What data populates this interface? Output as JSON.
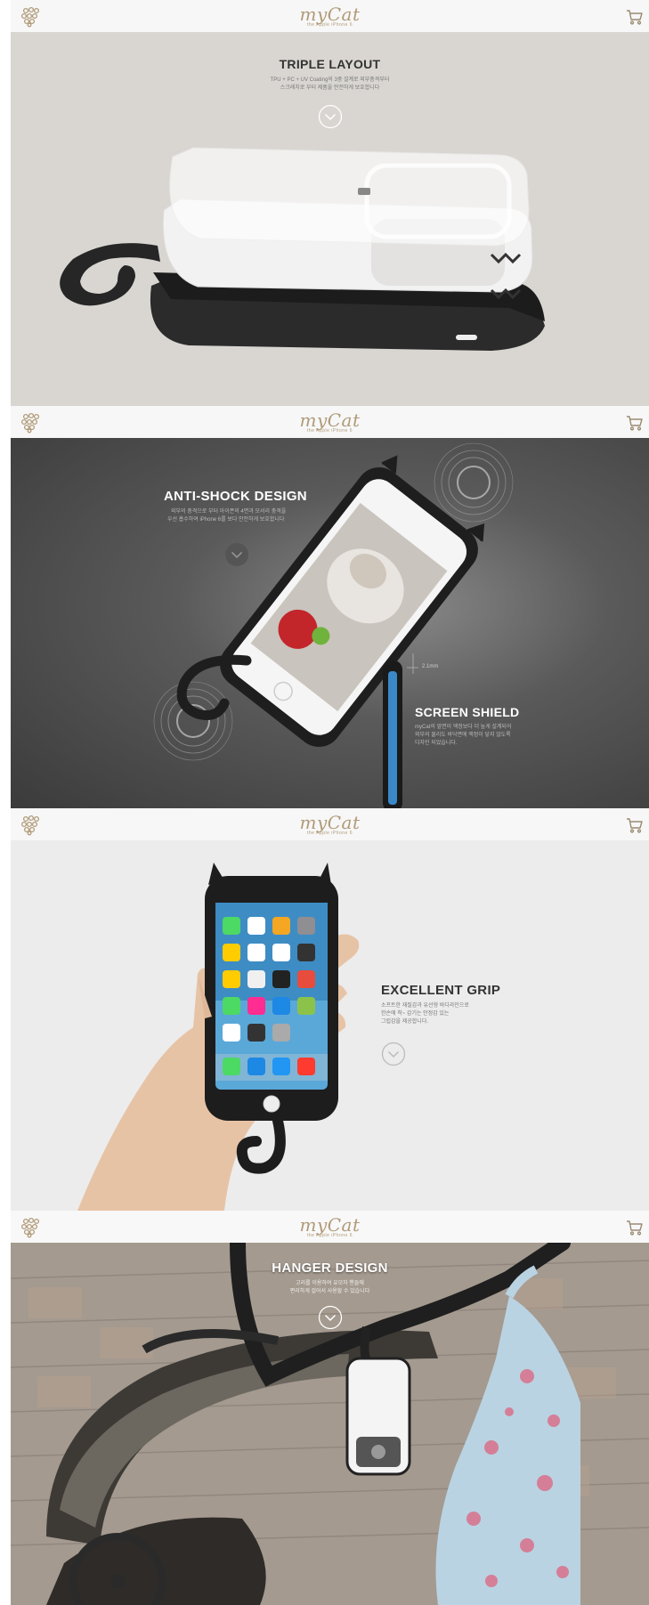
{
  "header": {
    "brand": "myCat",
    "brand_sub": "the Apple iPhone 6"
  },
  "section1": {
    "title": "TRIPLE LAYOUT",
    "desc_line1": "TPU + PC + UV Coating의 3중 설계로 외부충격부터",
    "desc_line2": "스크래치로 부터 제품을 안전하게 보호합니다"
  },
  "section2": {
    "title": "ANTI-SHOCK DESIGN",
    "desc_line1": "외부의 충격으로 부터 아이폰의 4면과 모서리 충격을",
    "desc_line2": "우선 흡수하여 iPhone 6를 보다 안전하게 보호합니다",
    "shield_title": "SCREEN SHIELD",
    "shield_desc_line1": "myCat의 앞면이 액정보다 더 높게 설계되어",
    "shield_desc_line2": "외부의 물리도 바닥면에 액정이 닿지 않도록",
    "shield_desc_line3": "디자인 되었습니다.",
    "measure": "2.1mm"
  },
  "section3": {
    "title": "EXCELLENT GRIP",
    "desc_line1": "소프트한 재질감과 유선형 바디라인으로",
    "desc_line2": "한손에 착~ 감기는 안정감 있는",
    "desc_line3": "그립감을 제공합니다."
  },
  "section4": {
    "title": "HANGER DESIGN",
    "desc_line1": "고리를 이용하여 유모차 핸들에",
    "desc_line2": "편리하게 걸어서 사용할 수 있습니다"
  },
  "colors": {
    "brand": "#b09a78",
    "dark_text": "#333333",
    "light_text": "#ffffff"
  }
}
